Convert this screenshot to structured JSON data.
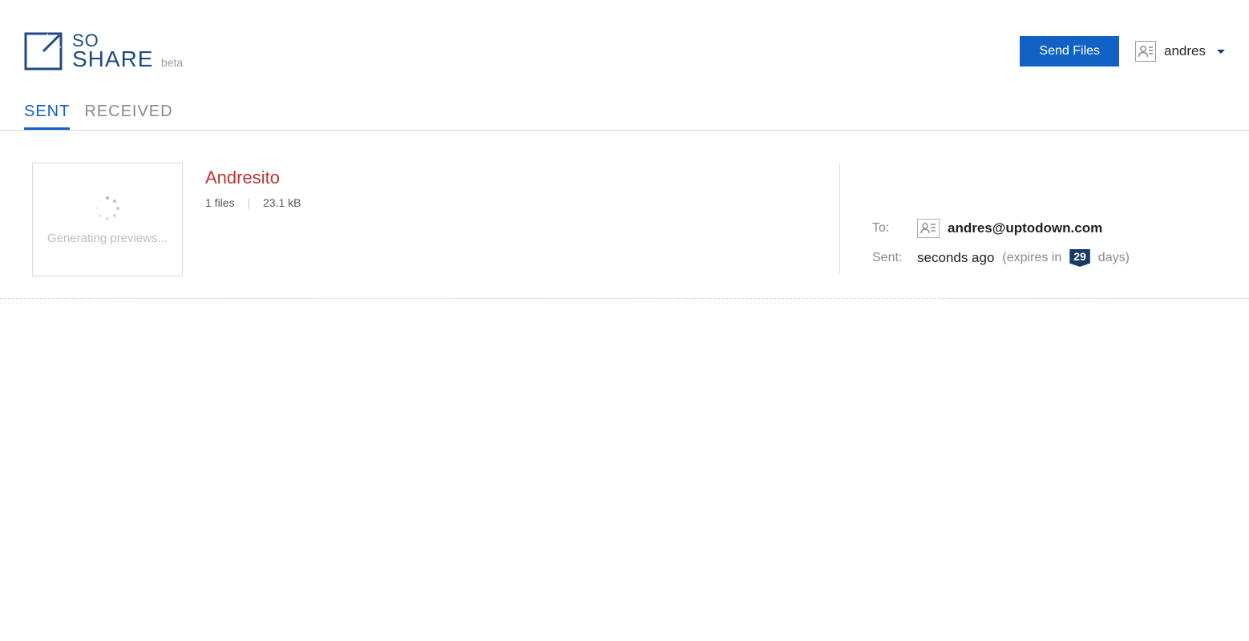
{
  "header": {
    "logo_line1": "SO",
    "logo_line2": "SHARE",
    "beta_suffix": "beta",
    "send_button_label": "Send Files",
    "username": "andres"
  },
  "tabs": {
    "sent": "SENT",
    "received": "RECEIVED"
  },
  "item": {
    "thumb_status": "Generating previews...",
    "title": "Andresito",
    "files_count": "1 files",
    "size": "23.1 kB"
  },
  "details": {
    "to_label": "To:",
    "to_email": "andres@uptodown.com",
    "sent_label": "Sent:",
    "sent_time": "seconds ago",
    "expires_prefix": "(expires in",
    "expires_days": "29",
    "expires_suffix": "days)"
  }
}
